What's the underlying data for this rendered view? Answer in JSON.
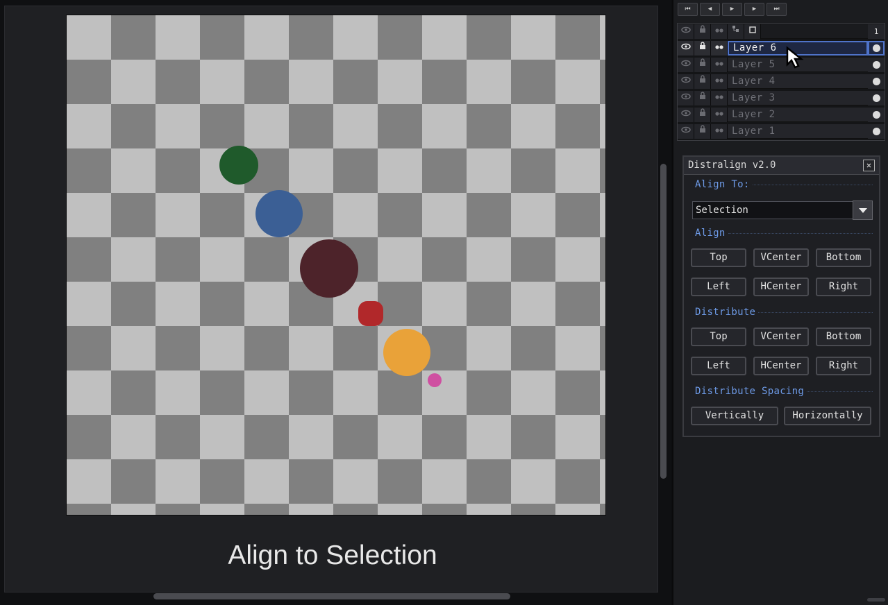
{
  "canvas": {
    "caption": "Align to Selection",
    "shapes": [
      {
        "name": "green-circle",
        "color": "#1f5a2b"
      },
      {
        "name": "blue-circle",
        "color": "#3b5f95"
      },
      {
        "name": "maroon-circle",
        "color": "#4d232a"
      },
      {
        "name": "red-diamond",
        "color": "#b1282a"
      },
      {
        "name": "orange-circle",
        "color": "#e9a239"
      },
      {
        "name": "pink-dot",
        "color": "#cf4fa1"
      }
    ]
  },
  "frame_controls": [
    {
      "name": "first-frame",
      "icon": "skip-back-icon",
      "glyph": "⏮"
    },
    {
      "name": "prev-frame",
      "icon": "step-back-icon",
      "glyph": "◀"
    },
    {
      "name": "play",
      "icon": "play-icon",
      "glyph": "▶"
    },
    {
      "name": "next-frame",
      "icon": "step-forward-icon",
      "glyph": "▶"
    },
    {
      "name": "last-frame",
      "icon": "skip-forward-icon",
      "glyph": "⏭"
    }
  ],
  "layers": {
    "frame_number": "1",
    "items": [
      {
        "label": "Layer 6",
        "selected": true
      },
      {
        "label": "Layer 5",
        "selected": false
      },
      {
        "label": "Layer 4",
        "selected": false
      },
      {
        "label": "Layer 3",
        "selected": false
      },
      {
        "label": "Layer 2",
        "selected": false
      },
      {
        "label": "Layer 1",
        "selected": false
      }
    ]
  },
  "dialog": {
    "title": "Distralign v2.0",
    "close_glyph": "✕",
    "align_to_label": "Align To:",
    "align_to_value": "Selection",
    "align_label": "Align",
    "align_buttons": [
      "Top",
      "VCenter",
      "Bottom",
      "Left",
      "HCenter",
      "Right"
    ],
    "distribute_label": "Distribute",
    "distribute_buttons": [
      "Top",
      "VCenter",
      "Bottom",
      "Left",
      "HCenter",
      "Right"
    ],
    "spacing_label": "Distribute Spacing",
    "spacing_buttons": [
      "Vertically",
      "Horizontally"
    ]
  },
  "colors": {
    "accent": "#6e9be8",
    "selection_border": "#4f73c9"
  }
}
